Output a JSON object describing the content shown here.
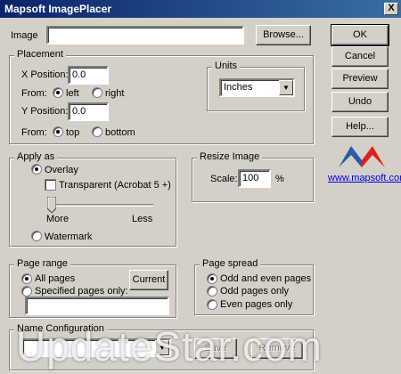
{
  "window": {
    "title": "Mapsoft ImagePlacer",
    "close_glyph": "X"
  },
  "image": {
    "label": "Image",
    "value": "",
    "browse_label": "Browse..."
  },
  "side_buttons": {
    "ok": "OK",
    "cancel": "Cancel",
    "preview": "Preview",
    "undo": "Undo",
    "help": "Help..."
  },
  "brand": {
    "link_text": "www.mapsoft.com",
    "colors": {
      "blue": "#2a5aa8",
      "red": "#e0201c"
    }
  },
  "placement": {
    "title": "Placement",
    "x_label": "X Position:",
    "x_value": "0.0",
    "x_from_label": "From:",
    "x_from_options": [
      "left",
      "right"
    ],
    "x_from_selected": "left",
    "y_label": "Y Position:",
    "y_value": "0.0",
    "y_from_label": "From:",
    "y_from_options": [
      "top",
      "bottom"
    ],
    "y_from_selected": "top",
    "units": {
      "title": "Units",
      "selected": "Inches"
    }
  },
  "apply_as": {
    "title": "Apply as",
    "overlay_label": "Overlay",
    "overlay_selected": true,
    "transparent_label": "Transparent (Acrobat 5 +)",
    "transparent_checked": false,
    "slider_more": "More",
    "slider_less": "Less",
    "slider_level": 0,
    "watermark_label": "Watermark"
  },
  "resize": {
    "title": "Resize Image",
    "scale_label": "Scale:",
    "scale_value": "100",
    "unit": "%"
  },
  "page_range": {
    "title": "Page range",
    "all_label": "All pages",
    "all_selected": true,
    "specified_label": "Specified pages only:",
    "current_label": "Current",
    "pages_value": ""
  },
  "page_spread": {
    "title": "Page spread",
    "options": [
      "Odd and even pages",
      "Odd pages only",
      "Even pages only"
    ],
    "selected": "Odd and even pages"
  },
  "name_config": {
    "title": "Name Configuration",
    "save_label": "Save",
    "remove_label": "Remove"
  },
  "overlay_watermark": {
    "text": "UpdateStar.com"
  }
}
